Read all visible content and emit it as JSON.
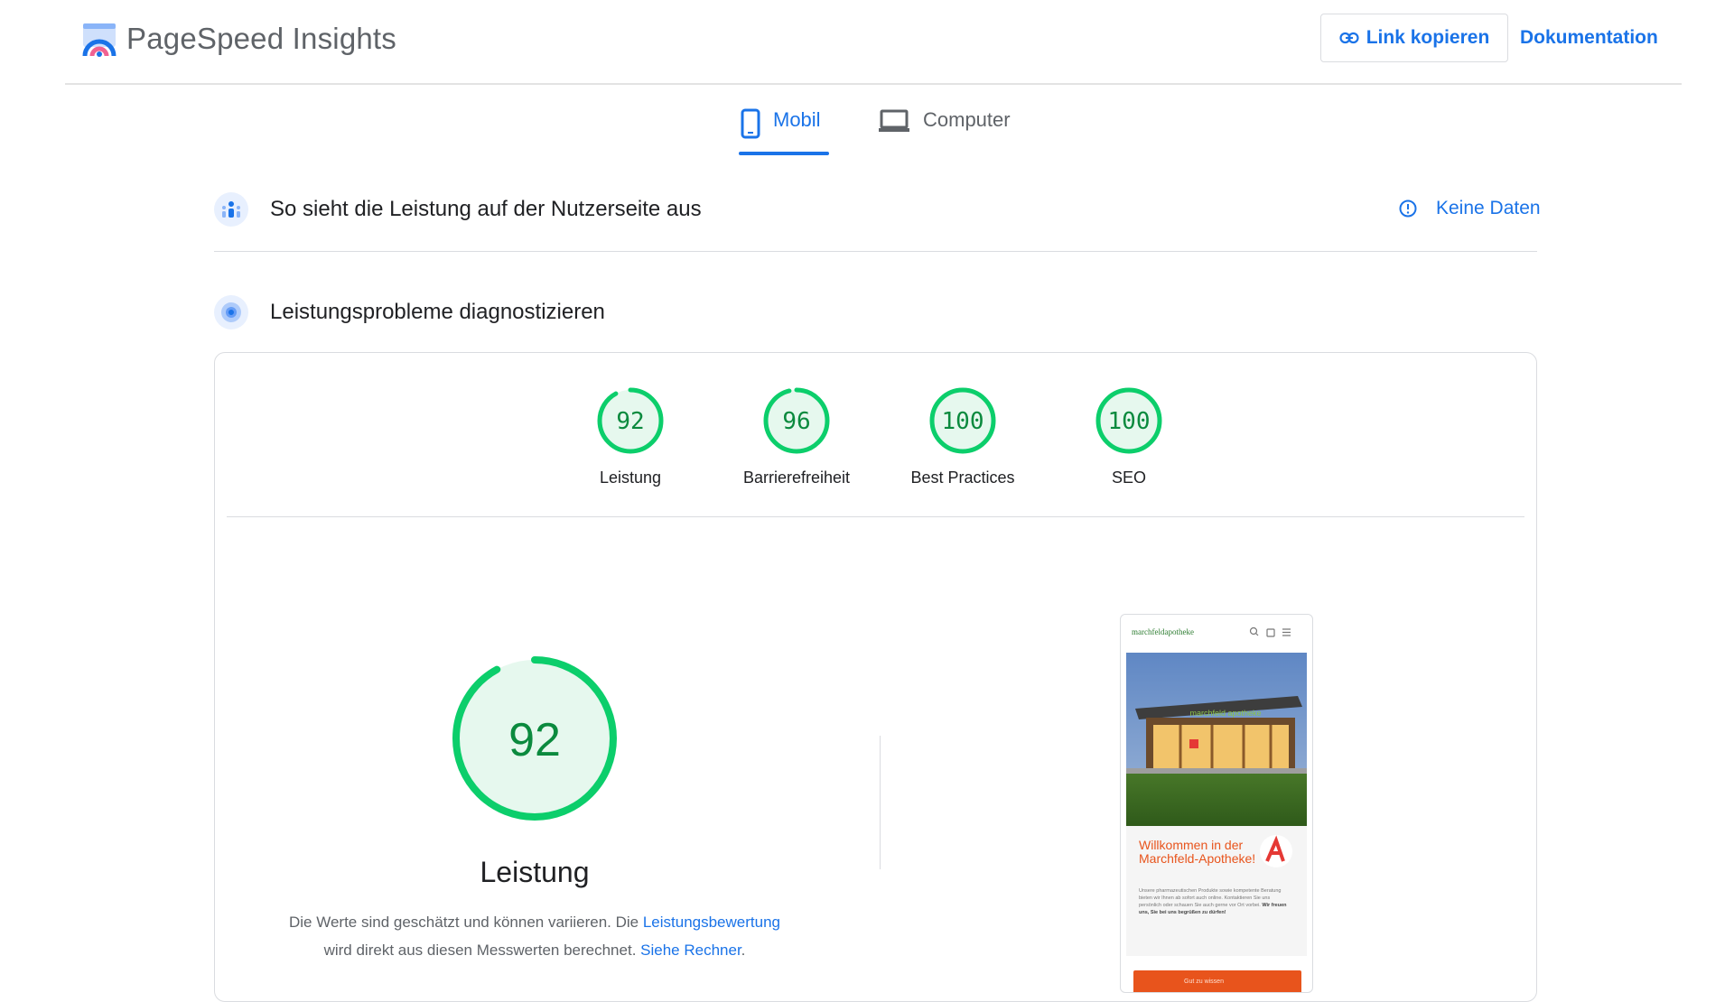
{
  "app": {
    "title": "PageSpeed Insights"
  },
  "header": {
    "copy_link_label": "Link kopieren",
    "documentation_label": "Dokumentation"
  },
  "tabs": [
    {
      "label": "Mobil",
      "active": true
    },
    {
      "label": "Computer",
      "active": false
    }
  ],
  "field_data": {
    "title": "So sieht die Leistung auf der Nutzerseite aus",
    "status_label": "Keine Daten"
  },
  "diagnose": {
    "title": "Leistungsprobleme diagnostizieren",
    "scores": [
      {
        "label": "Leistung",
        "value": "92",
        "fraction": 0.92
      },
      {
        "label": "Barrierefreiheit",
        "value": "96",
        "fraction": 0.96
      },
      {
        "label": "Best Practices",
        "value": "100",
        "fraction": 1.0
      },
      {
        "label": "SEO",
        "value": "100",
        "fraction": 1.0
      }
    ]
  },
  "performance": {
    "score": "92",
    "fraction": 0.92,
    "title": "Leistung",
    "desc_part1": "Die Werte sind geschätzt und können variieren. Die ",
    "desc_link1": "Leistungsbewertung",
    "desc_part2": "wird direkt aus diesen Messwerten berechnet. ",
    "desc_link2": "Siehe Rechner",
    "desc_end": "."
  },
  "screenshot": {
    "brand": "marchfeldapotheke",
    "sign_text": "marchfeld apotheke",
    "headline": "Willkommen in der Marchfeld-Apotheke!",
    "body_text": "Unsere pharmazeutischen Produkte sowie kompetente Beratung bieten wir Ihnen ab sofort auch online. Kontaktieren Sie uns persönlich oder schauen Sie auch gerne vor Ort vorbei.",
    "body_bold": "Wir freuen uns, Sie bei uns begrüßen zu dürfen!",
    "cta_label": "Gut zu wissen"
  },
  "colors": {
    "accent": "#1a73e8",
    "pass": "#0cce6b",
    "pass_bg": "#e6f8ee",
    "pass_text": "#0b8a3e",
    "brand_orange": "#e8541c"
  }
}
